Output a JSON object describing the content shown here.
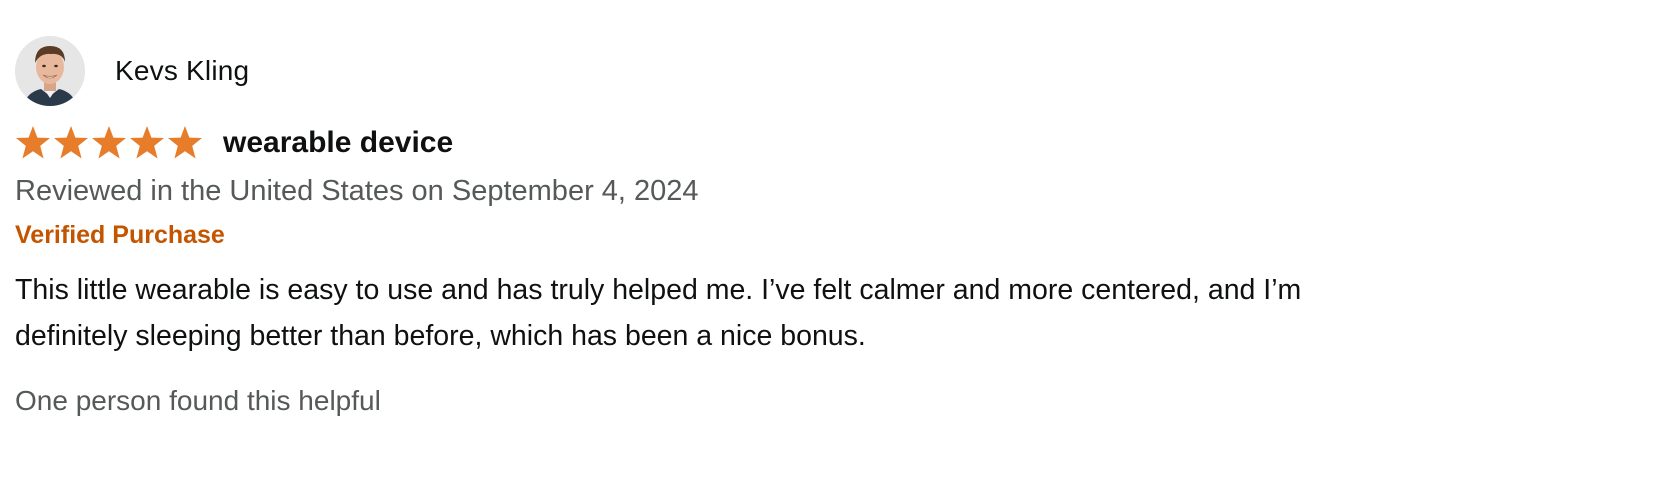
{
  "review": {
    "profile_name": "Kevs Kling",
    "rating": 5,
    "rating_max": 5,
    "star_color": "#e77c2a",
    "title": "wearable device",
    "date_line": "Reviewed in the United States on September 4, 2024",
    "verified_label": "Verified Purchase",
    "verified_color": "#c45500",
    "body_line1": "This little wearable is easy to use and has truly helped me. I’ve felt calmer and more centered, and I’m",
    "body_line2": "definitely sleeping better than before, which has been a nice bonus.",
    "helpful_text": "One person found this helpful"
  },
  "icons": {
    "avatar": "user-avatar-photo",
    "star": "star-icon"
  }
}
